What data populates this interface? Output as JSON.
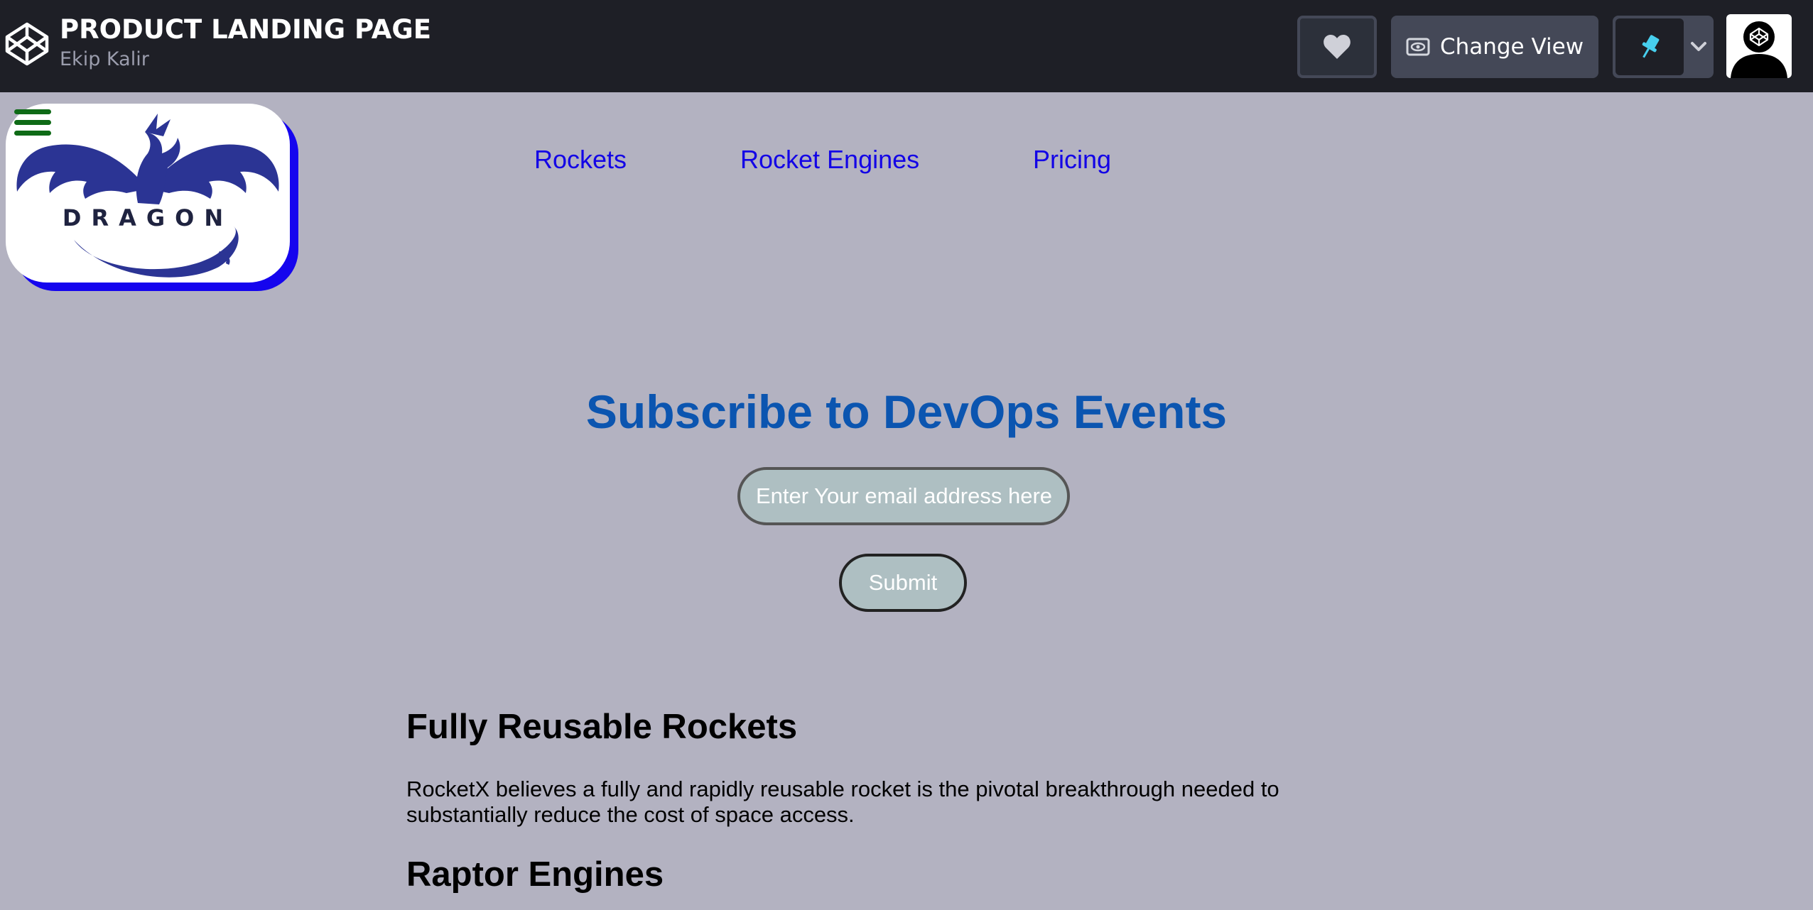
{
  "topbar": {
    "title": "PRODUCT LANDING PAGE",
    "author": "Ekip Kalir",
    "change_view_label": "Change View",
    "icons": [
      "codepen-logo-icon",
      "heart-icon",
      "eye-icon",
      "pin-icon",
      "chevron-down-icon",
      "avatar"
    ],
    "colors": {
      "background": "#1e1f26",
      "button": "#444857",
      "pin": "#47cf73"
    }
  },
  "header": {
    "logo_text": "DRAGON",
    "menu_icon": "hamburger-icon",
    "nav": [
      {
        "label": "Rockets"
      },
      {
        "label": "Rocket Engines"
      },
      {
        "label": "Pricing"
      }
    ]
  },
  "subscribe": {
    "title": "Subscribe to DevOps Events",
    "email_placeholder": "Enter Your email address here",
    "submit_label": "Submit"
  },
  "sections": [
    {
      "title": "Fully Reusable Rockets",
      "text": "RocketX believes a fully and rapidly reusable rocket is the pivotal breakthrough needed to substantially reduce the cost of space access."
    },
    {
      "title": "Raptor Engines"
    }
  ],
  "colors": {
    "page_background": "#b3b2c1",
    "nav_link": "#1303e6",
    "subscribe_title": "#0b55b0",
    "logo_shadow": "#1505ee",
    "logo_ink": "#2b3494",
    "input_background": "#aebfc2",
    "hamburger": "#0e6a16"
  }
}
